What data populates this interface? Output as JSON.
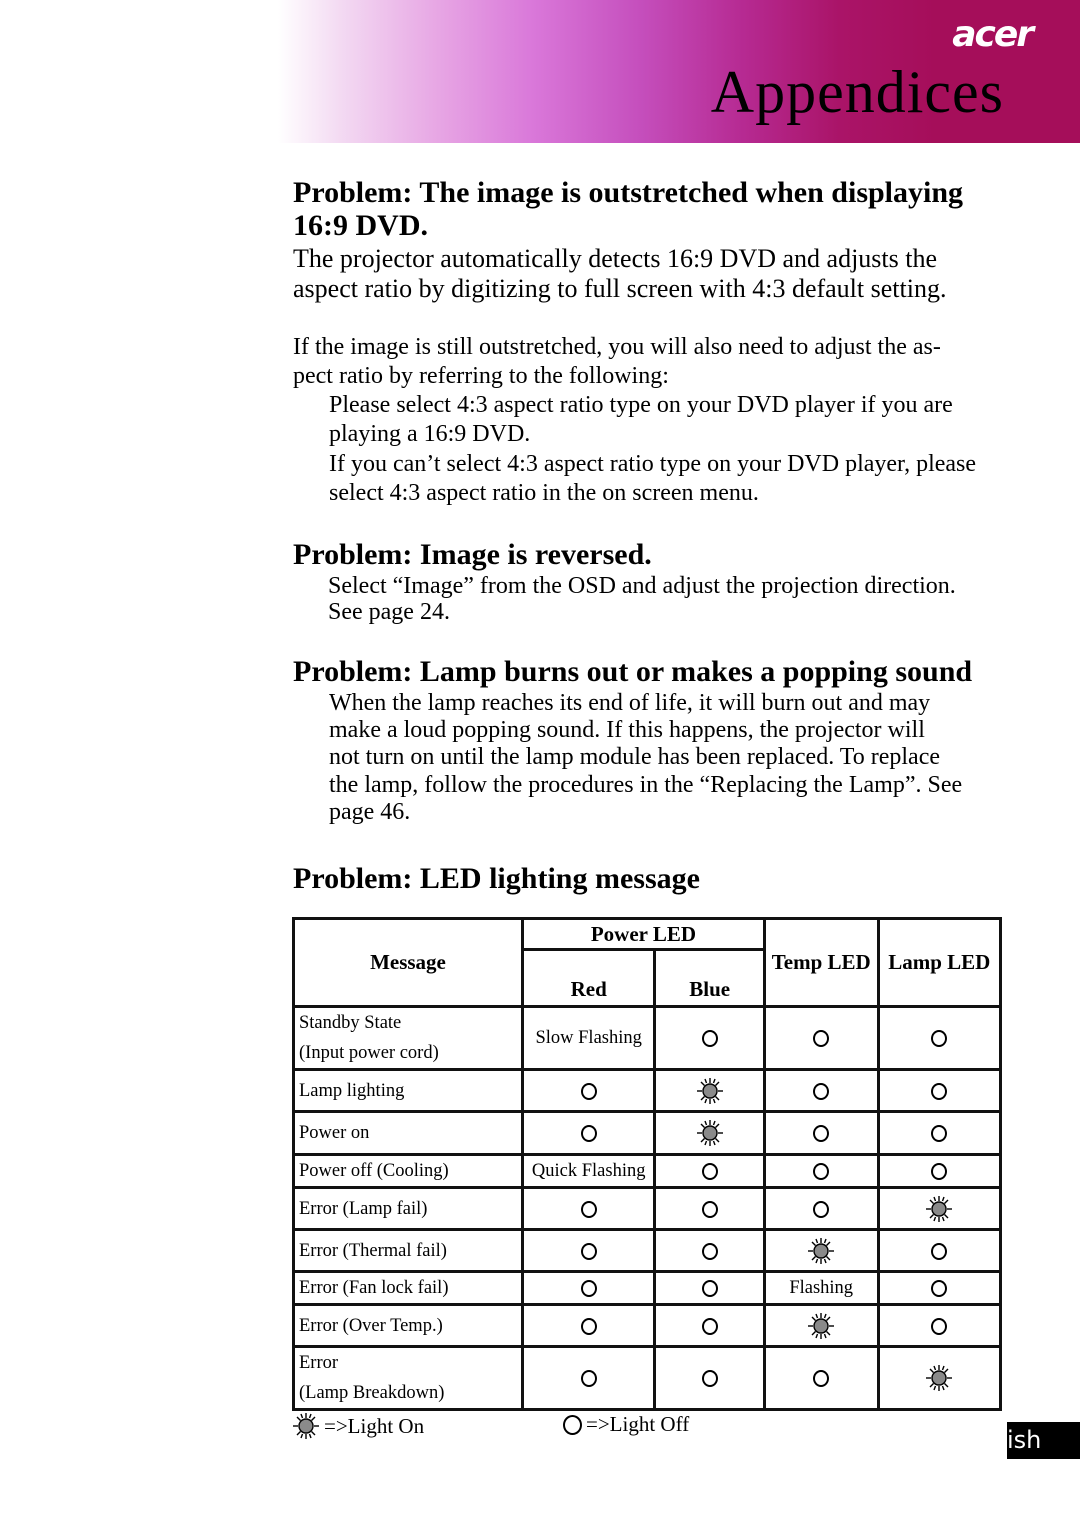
{
  "header": {
    "brand": "acer",
    "title": "Appendices",
    "banner_colors": {
      "start": "#ffffff",
      "mid": "#d977d9",
      "end": "#a50e5a"
    }
  },
  "sections": [
    {
      "heading_line1": "Problem: The image is outstretched when displaying",
      "heading_line2": "16:9 DVD.",
      "lead_line1": "The projector automatically detects 16:9 DVD and adjusts the",
      "lead_line2": "aspect ratio by digitizing to full screen with 4:3 default setting.",
      "body_line1": "If the image is still outstretched, you will also need to adjust the as-",
      "body_line2": "pect ratio by referring to the following:",
      "bullets": [
        {
          "line1": "Please select 4:3 aspect ratio type on your DVD player if you are",
          "line2": "playing a 16:9 DVD."
        },
        {
          "line1": "If you can’t select 4:3 aspect ratio type on your DVD player, please",
          "line2": "select 4:3 aspect ratio in the on screen menu."
        }
      ]
    },
    {
      "heading": "Problem: Image is reversed.",
      "body_line1": "Select “Image” from the OSD and adjust the projection direction.",
      "body_line2": "See page 24."
    },
    {
      "heading": "Problem: Lamp burns out or makes a popping sound",
      "body_lines": [
        "When the lamp reaches its end of life, it will burn out and may",
        "make a loud popping sound.  If this happens, the projector will",
        "not turn on until the lamp module has been replaced. To replace",
        "the lamp, follow the procedures in the “Replacing the Lamp”. See",
        "page 46."
      ]
    },
    {
      "heading": "Problem: LED lighting message"
    }
  ],
  "led_table": {
    "headers": {
      "message": "Message",
      "power_led": "Power LED",
      "red": "Red",
      "blue": "Blue",
      "temp_led": "Temp LED",
      "lamp_led": "Lamp LED"
    },
    "rows": [
      {
        "message": "Standby State",
        "message2": "(Input power cord)",
        "red": "Slow Flashing",
        "blue": "off",
        "temp": "off",
        "lamp": "off"
      },
      {
        "message": "Lamp lighting",
        "message2": "",
        "red": "off",
        "blue": "on",
        "temp": "off",
        "lamp": "off"
      },
      {
        "message": "Power on",
        "message2": "",
        "red": "off",
        "blue": "on",
        "temp": "off",
        "lamp": "off"
      },
      {
        "message": "Power off (Cooling)",
        "message2": "",
        "red": "Quick Flashing",
        "blue": "off",
        "temp": "off",
        "lamp": "off"
      },
      {
        "message": "Error (Lamp fail)",
        "message2": "",
        "red": "off",
        "blue": "off",
        "temp": "off",
        "lamp": "on"
      },
      {
        "message": "Error (Thermal fail)",
        "message2": "",
        "red": "off",
        "blue": "off",
        "temp": "on",
        "lamp": "off"
      },
      {
        "message": "Error (Fan lock fail)",
        "message2": "",
        "red": "off",
        "blue": "off",
        "temp": "Flashing",
        "lamp": "off"
      },
      {
        "message": "Error (Over Temp.)",
        "message2": "",
        "red": "off",
        "blue": "off",
        "temp": "on",
        "lamp": "off"
      },
      {
        "message": "Error",
        "message2": "(Lamp Breakdown)",
        "red": "off",
        "blue": "off",
        "temp": "off",
        "lamp": "on"
      }
    ]
  },
  "legend": {
    "on_label": "=>Light On",
    "off_label": "=>Light Off",
    "on_icon": "light-on-icon",
    "off_icon": "light-off-icon"
  },
  "footer": {
    "language_tab": "ish"
  }
}
